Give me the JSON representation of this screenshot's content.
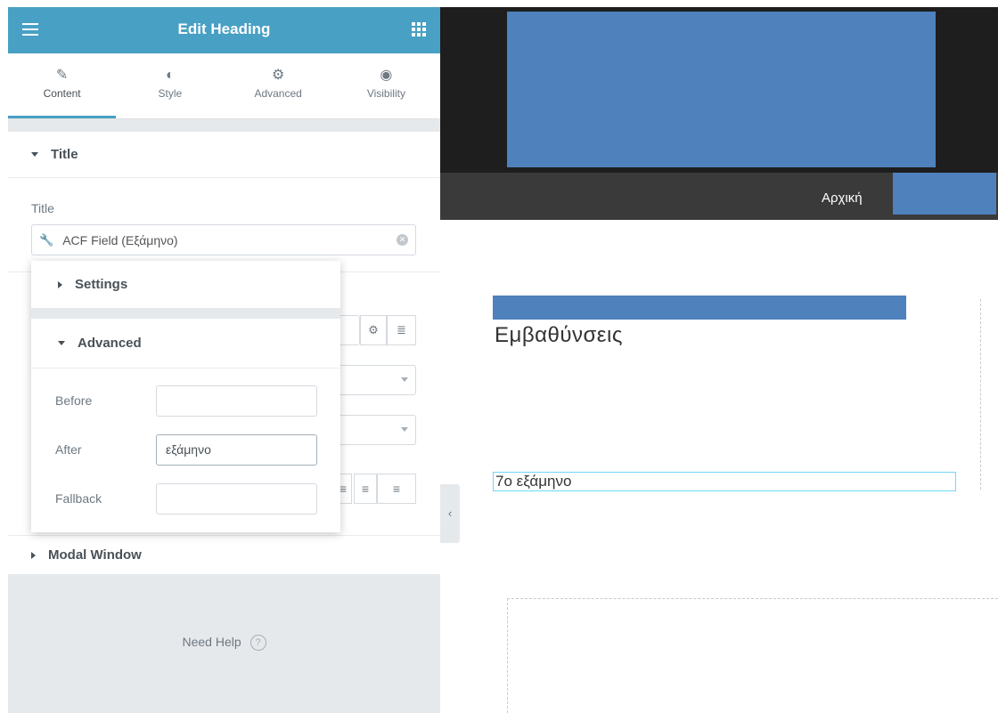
{
  "panel": {
    "header_title": "Edit Heading",
    "tabs": [
      {
        "label": "Content",
        "icon": "pencil-icon"
      },
      {
        "label": "Style",
        "icon": "half-circle-icon"
      },
      {
        "label": "Advanced",
        "icon": "gear-icon"
      },
      {
        "label": "Visibility",
        "icon": "eye-icon"
      }
    ],
    "title_section": "Title",
    "title_field_label": "Title",
    "title_field_value": "ACF Field (Εξάμηνο)",
    "modal_section": "Modal Window",
    "need_help": "Need Help",
    "need_help_icon": "?"
  },
  "popover": {
    "settings_label": "Settings",
    "advanced_label": "Advanced",
    "rows": [
      {
        "label": "Before",
        "value": ""
      },
      {
        "label": "After",
        "value": "εξάμηνο"
      },
      {
        "label": "Fallback",
        "value": ""
      }
    ]
  },
  "preview": {
    "nav_home": "Αρχική",
    "subtitle": "Εμβαθύνσεις",
    "heading_text": "7ο εξάμηνο"
  },
  "colors": {
    "accent": "#48a0c4",
    "redaction": "#4f81bd",
    "header_dark": "#1e1e1e",
    "nav_dark": "#3a3a3a"
  }
}
